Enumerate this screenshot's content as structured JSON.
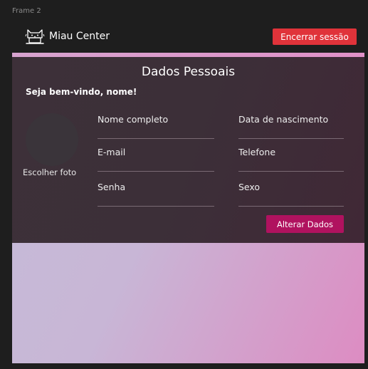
{
  "canvas": {
    "frame_label": "Frame 2"
  },
  "header": {
    "logo_icon": "cat-laptop-icon",
    "app_title": "Miau Center",
    "logout_label": "Encerrar sessão",
    "logout_color": "#e0333a"
  },
  "profile": {
    "title": "Dados Pessoais",
    "welcome": "Seja bem-vindo, nome!",
    "choose_photo": "Escolher foto",
    "fields": [
      {
        "label": "Nome completo"
      },
      {
        "label": "Data de nascimento"
      },
      {
        "label": "E-mail"
      },
      {
        "label": "Telefone"
      },
      {
        "label": "Senha"
      },
      {
        "label": "Sexo"
      }
    ],
    "update_label": "Alterar Dados",
    "update_color": "#b0125f"
  }
}
